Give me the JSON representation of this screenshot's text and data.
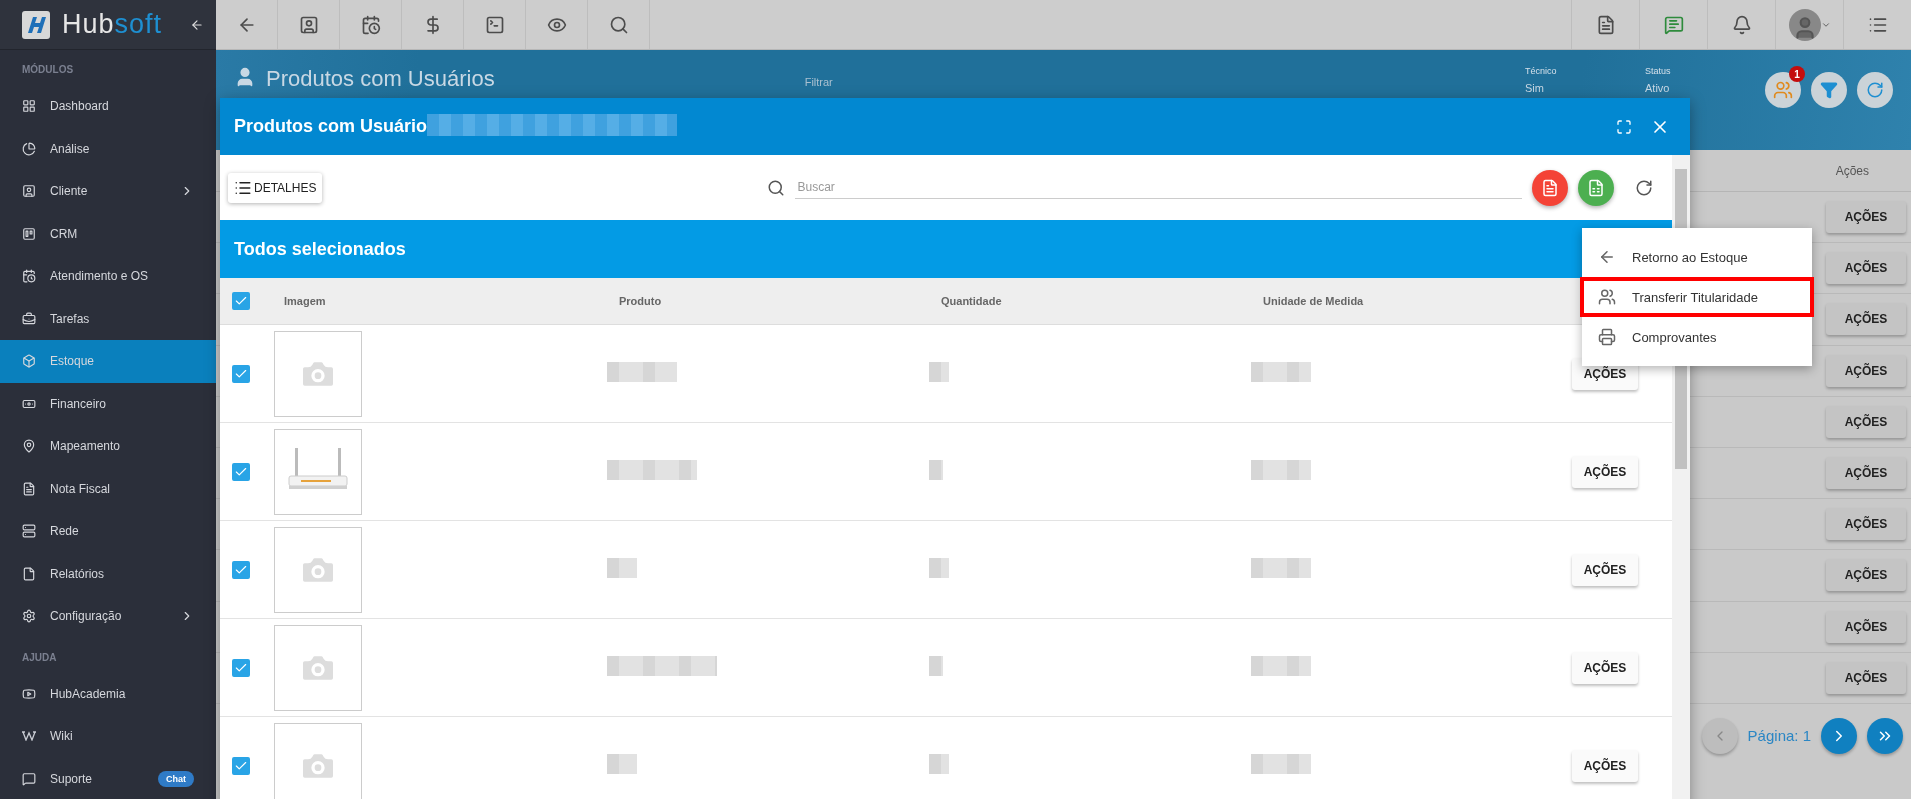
{
  "sidebar": {
    "logo": [
      "Hub",
      "soft"
    ],
    "sections": [
      {
        "title": "MÓDULOS",
        "items": [
          {
            "label": "Dashboard",
            "selected": false,
            "submenu": false
          },
          {
            "label": "Análise",
            "selected": false,
            "submenu": false
          },
          {
            "label": "Cliente",
            "selected": false,
            "submenu": true
          },
          {
            "label": "CRM",
            "selected": false,
            "submenu": false
          },
          {
            "label": "Atendimento e OS",
            "selected": false,
            "submenu": false
          },
          {
            "label": "Tarefas",
            "selected": false,
            "submenu": false
          },
          {
            "label": "Estoque",
            "selected": true,
            "submenu": false
          },
          {
            "label": "Financeiro",
            "selected": false,
            "submenu": false
          },
          {
            "label": "Mapeamento",
            "selected": false,
            "submenu": false
          },
          {
            "label": "Nota Fiscal",
            "selected": false,
            "submenu": false
          },
          {
            "label": "Rede",
            "selected": false,
            "submenu": false
          },
          {
            "label": "Relatórios",
            "selected": false,
            "submenu": false
          },
          {
            "label": "Configuração",
            "selected": false,
            "submenu": true
          }
        ]
      },
      {
        "title": "AJUDA",
        "items": [
          {
            "label": "HubAcademia",
            "selected": false,
            "submenu": false
          },
          {
            "label": "Wiki",
            "selected": false,
            "submenu": false
          },
          {
            "label": "Suporte",
            "selected": false,
            "submenu": false,
            "badge": "Chat"
          }
        ]
      }
    ]
  },
  "page": {
    "title": "Produtos com Usuários",
    "filter_placeholder": "Filtrar",
    "filters": [
      {
        "label": "Técnico",
        "value": "Sim"
      },
      {
        "label": "Status",
        "value": "Ativo"
      }
    ],
    "notification_count": "1",
    "actions_column": "Ações",
    "row_actions": [
      "AÇÕES",
      "AÇÕES",
      "AÇÕES",
      "AÇÕES",
      "AÇÕES",
      "AÇÕES",
      "AÇÕES",
      "AÇÕES",
      "AÇÕES",
      "AÇÕES"
    ],
    "pagination": "Página: 1"
  },
  "modal": {
    "title": "Produtos com Usuário",
    "details_button": "DETALHES",
    "search_placeholder": "Buscar",
    "selection_title": "Todos selecionados",
    "all_checked": true,
    "columns": [
      "Imagem",
      "Produto",
      "Quantidade",
      "Unidade de Medida"
    ],
    "rows": [
      {
        "checked": true,
        "kind": "camera",
        "action": "AÇÕES"
      },
      {
        "checked": true,
        "kind": "picture",
        "action": "AÇÕES"
      },
      {
        "checked": true,
        "kind": "camera",
        "action": "AÇÕES"
      },
      {
        "checked": true,
        "kind": "camera",
        "action": "AÇÕES"
      },
      {
        "checked": true,
        "kind": "camera",
        "action": "AÇÕES"
      }
    ]
  },
  "menu": {
    "items": [
      {
        "label": "Retorno ao Estoque",
        "highlighted": false
      },
      {
        "label": "Transferir Titularidade",
        "highlighted": true
      },
      {
        "label": "Comprovantes",
        "highlighted": false
      }
    ]
  }
}
